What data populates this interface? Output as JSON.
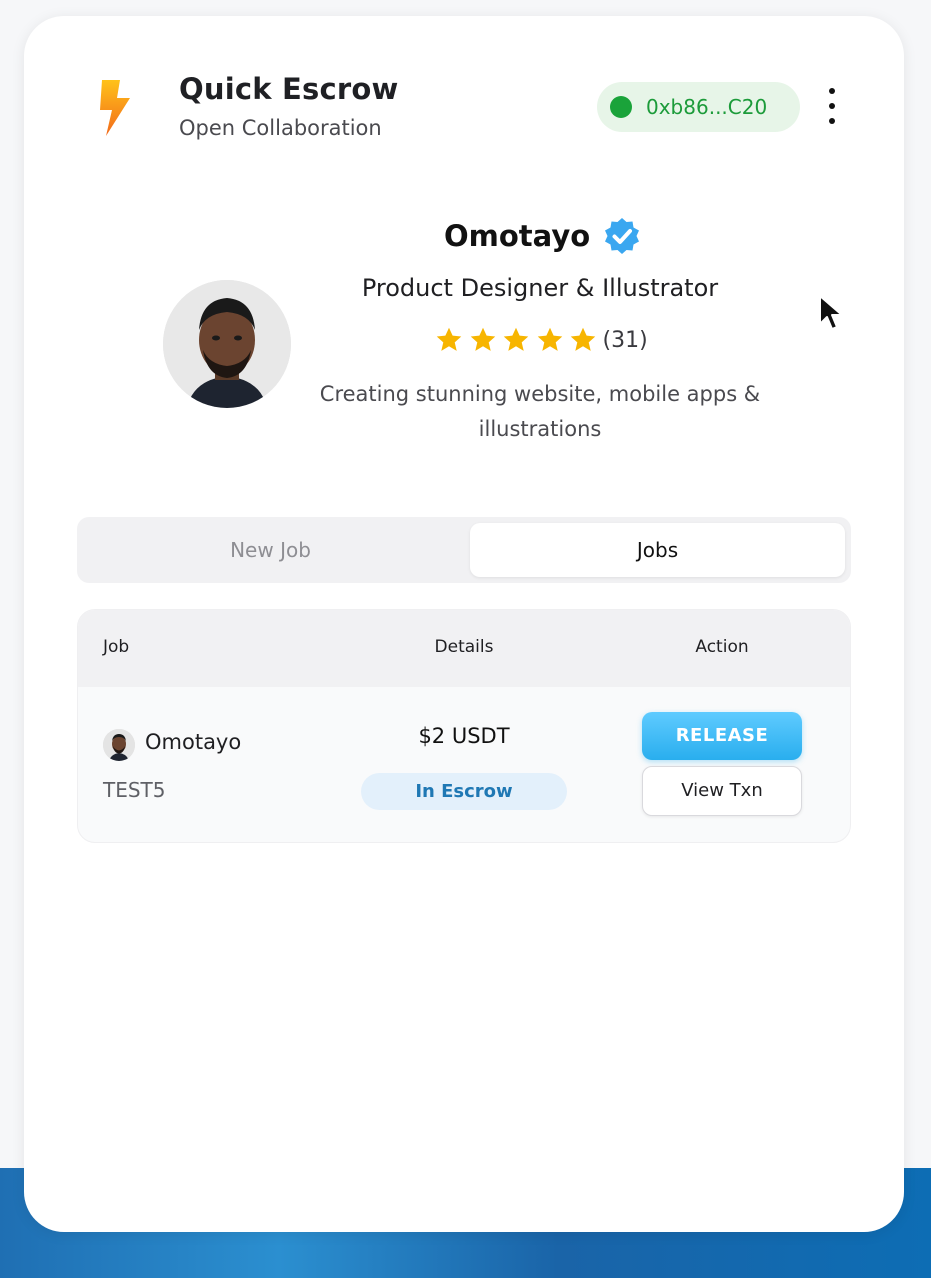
{
  "header": {
    "title": "Quick Escrow",
    "subtitle": "Open Collaboration",
    "wallet_address": "0xb86...C20",
    "logo_icon": "lightning-bolt-icon",
    "menu_icon": "kebab-menu-icon"
  },
  "profile": {
    "name": "Omotayo",
    "verified_icon": "verified-badge-icon",
    "role": "Product Designer & Illustrator",
    "rating_stars": 5,
    "rating_count": "(31)",
    "bio": "Creating stunning website, mobile apps & illustrations"
  },
  "tabs": [
    {
      "label": "New Job",
      "active": false
    },
    {
      "label": "Jobs",
      "active": true
    }
  ],
  "table": {
    "headers": {
      "job": "Job",
      "details": "Details",
      "action": "Action"
    },
    "rows": [
      {
        "name": "Omotayo",
        "code": "TEST5",
        "amount": "$2 USDT",
        "status": "In Escrow",
        "primary_action": "RELEASE",
        "secondary_action": "View Txn"
      }
    ]
  },
  "colors": {
    "accent": "#29aeee",
    "wallet_green": "#1aa33a",
    "status_blue": "#1f78b4",
    "star_yellow": "#f7b500"
  }
}
